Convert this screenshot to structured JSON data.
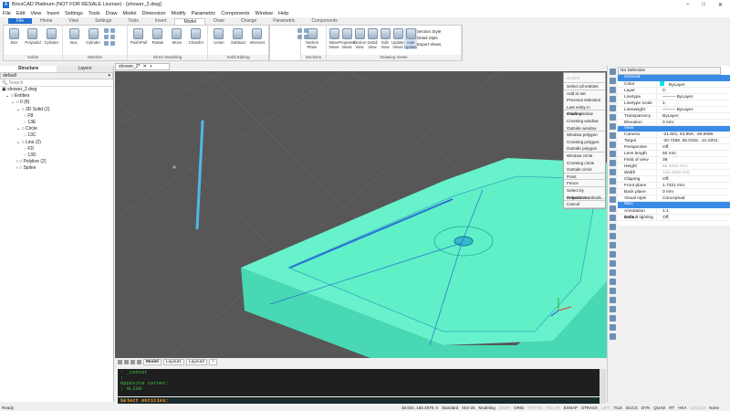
{
  "title": "BricsCAD Platinum (NOT FOR RESALE License) - [shower_2.dwg]",
  "menu": [
    "File",
    "Edit",
    "View",
    "Insert",
    "Settings",
    "Tools",
    "Draw",
    "Model",
    "Dimension",
    "Modify",
    "Parametric",
    "Components",
    "Window",
    "Help"
  ],
  "ribbon_tabs": [
    "File",
    "Home",
    "View",
    "Settings",
    "Tools",
    "Insert",
    "Model",
    "Draw",
    "Change",
    "Parametric",
    "Components"
  ],
  "active_tab": "Model",
  "ribbon": {
    "solids": {
      "label": "Solids",
      "tools": [
        "Box",
        "Polysolid",
        "Cylinder"
      ]
    },
    "meshes": {
      "label": "Meshes",
      "tools": [
        "Box",
        "Cylinder"
      ]
    },
    "direct": {
      "label": "Direct Modeling",
      "tools": [
        "Push/Pull",
        "Rotate",
        "Move",
        "Chamfer"
      ]
    },
    "solid_edit": {
      "label": "Solid Editing",
      "tools": [
        "Union",
        "Subtract",
        "Intersect"
      ]
    },
    "sections": {
      "label": "Sections",
      "tools": [
        "Section Plane"
      ]
    },
    "drawing_views": {
      "label": "Drawing Views",
      "tools": [
        "Base Views",
        "Projected Views",
        "Section View",
        "Detail View",
        "Edit View",
        "Update Views",
        "Auto Update"
      ],
      "side": [
        "Section Style",
        "Detail Style",
        "Export Views"
      ]
    }
  },
  "structure": {
    "tabs": [
      "Structure",
      "Layers"
    ],
    "filter": "default",
    "search_placeholder": "Search",
    "tree": [
      "shower_2.dwg",
      "Entities",
      "0 (8)",
      "3D Solid (2)",
      "F8",
      "13E",
      "Circle",
      "13C",
      "Line (2)",
      "FD",
      "13D",
      "Polyline (2)",
      "Spline"
    ]
  },
  "viewport_tab": "shower_2*",
  "context_menu": {
    "title": "ALIGN",
    "items": [
      "Select all entities",
      "Add to set",
      "Previous selection",
      "Last entity in drawing",
      "Inside window",
      "Crossing window",
      "Outside window",
      "Window polygon",
      "Crossing polygon",
      "Outside polygon",
      "Window circle",
      "Crossing circle",
      "Outside circle",
      "Point",
      "Fence",
      "Select by Properties...",
      "Selection Methods...",
      "Cancel"
    ]
  },
  "properties": {
    "selection": "No Selection",
    "sections": [
      {
        "name": "General",
        "rows": [
          [
            "Color",
            "ByLayer"
          ],
          [
            "Layer",
            "0"
          ],
          [
            "Linetype",
            "——— ByLayer"
          ],
          [
            "Linetype scale",
            "1"
          ],
          [
            "Lineweight",
            "——— ByLayer"
          ],
          [
            "Transparency",
            "ByLayer"
          ],
          [
            "Elevation",
            "0 mm"
          ]
        ]
      },
      {
        "name": "View",
        "rows": [
          [
            "Camera",
            "-21.601, 63.959, -29.9699"
          ],
          [
            "Target",
            "-20.7369, 65.0316, -31.0201"
          ],
          [
            "Perspective",
            "Off"
          ],
          [
            "Lens length",
            "50 mm"
          ],
          [
            "Field of view",
            "39"
          ],
          [
            "Height",
            "86.3042 mm"
          ],
          [
            "Width",
            "146.4089 mm"
          ],
          [
            "Clipping",
            "Off"
          ],
          [
            "Front plane",
            "1.7321 mm"
          ],
          [
            "Back plane",
            "0 mm"
          ],
          [
            "Visual style",
            "Conceptual"
          ]
        ]
      },
      {
        "name": "Misc",
        "rows": [
          [
            "Annotation scale",
            "1:1"
          ],
          [
            "Default lighting",
            "Off"
          ]
        ]
      }
    ],
    "color_swatch": "#00e5e5"
  },
  "layout_tabs": [
    "Model",
    "Layout1",
    "Layout2",
    "+"
  ],
  "command_history": [
    ": _center",
    ":",
    "Opposite corner:",
    ": ALIGN"
  ],
  "command_prompt": "Select entities:",
  "status": {
    "ready": "Ready",
    "coords": "38.934, 168.4979, 0",
    "items": [
      "Standard",
      "ISO-25",
      "Modeling",
      "SNAP",
      "GRID",
      "ORTHO",
      "POLAR",
      "ESNAP",
      "STRACK",
      "LWT",
      "TILE",
      "DUCS",
      "DYN",
      "QUAD",
      "RT",
      "HKA",
      "LOCKUI",
      "None"
    ],
    "off": [
      "SNAP",
      "ORTHO",
      "POLAR",
      "LWT",
      "LOCKUI"
    ]
  }
}
